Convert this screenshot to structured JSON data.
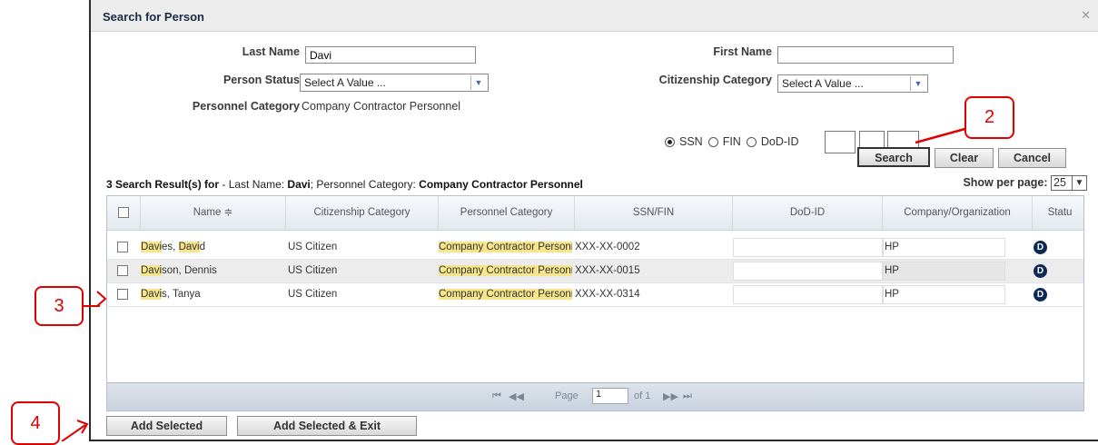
{
  "dialog": {
    "title": "Search for Person",
    "close_glyph": "✕"
  },
  "form": {
    "last_name": {
      "label": "Last Name",
      "value": "Davi"
    },
    "first_name": {
      "label": "First Name",
      "value": ""
    },
    "person_status": {
      "label": "Person Status",
      "value": "Select A Value ..."
    },
    "citizenship_category": {
      "label": "Citizenship Category",
      "value": "Select A Value ..."
    },
    "personnel_category": {
      "label": "Personnel Category",
      "value": "Company Contractor Personnel"
    },
    "id_type": {
      "options": [
        "SSN",
        "FIN",
        "DoD-ID"
      ],
      "selected": "SSN"
    }
  },
  "buttons": {
    "search": "Search",
    "clear": "Clear",
    "cancel": "Cancel",
    "add_selected": "Add Selected",
    "add_selected_exit": "Add Selected & Exit"
  },
  "results": {
    "count_text": "3 Search Result(s) for",
    "criteria_prefix": " - Last Name: ",
    "last_name": "Davi",
    "criteria_mid": "; Personnel Category: ",
    "category": "Company Contractor Personnel",
    "per_page_label": "Show per page:",
    "per_page_value": "25"
  },
  "table": {
    "columns": [
      "Name ≑",
      "Citizenship Category",
      "Personnel Category",
      "SSN/FIN",
      "DoD-ID",
      "Company/Organization",
      "Statu"
    ],
    "rows": [
      {
        "name_hl1": "Davi",
        "name_rest1": "es, ",
        "name_hl2": "Davi",
        "name_rest2": "d",
        "citizenship": "US Citizen",
        "category": "Company Contractor Personn",
        "ssn": "XXX-XX-0002",
        "dod": "",
        "company": "HP",
        "status": "D"
      },
      {
        "name_hl1": "Davi",
        "name_rest1": "son, Dennis",
        "name_hl2": "",
        "name_rest2": "",
        "citizenship": "US Citizen",
        "category": "Company Contractor Personn",
        "ssn": "XXX-XX-0015",
        "dod": "",
        "company": "HP",
        "status": "D"
      },
      {
        "name_hl1": "Davi",
        "name_rest1": "s, Tanya",
        "name_hl2": "",
        "name_rest2": "",
        "citizenship": "US Citizen",
        "category": "Company Contractor Personn",
        "ssn": "XXX-XX-0314",
        "dod": "",
        "company": "HP",
        "status": "D"
      }
    ]
  },
  "pager": {
    "first": "⏮",
    "prev": "◀◀",
    "page_label": "Page",
    "page_value": "1",
    "of_label": "of 1",
    "next": "▶▶",
    "last": "⏭"
  },
  "callouts": [
    "2",
    "3",
    "4"
  ],
  "colors": {
    "callout": "#e00000",
    "highlight": "#f6e58a"
  }
}
